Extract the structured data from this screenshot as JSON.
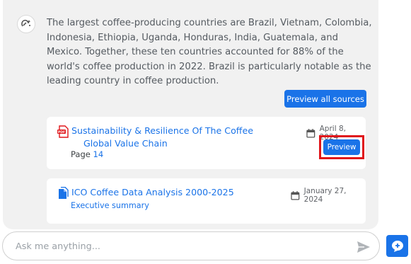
{
  "message": {
    "text": "The largest coffee-producing countries are Brazil, Vietnam, Colombia, Indonesia, Ethiopia, Uganda, Honduras, India, Guatemala, and Mexico. Together, these ten countries accounted for 88% of the world's coffee production in 2022. Brazil is particularly notable as the leading country in coffee production.",
    "preview_all_label": "Preview all sources"
  },
  "sources": [
    {
      "icon": "pdf-icon",
      "title_line1": "Sustainability & Resilience Of The Coffee",
      "title_line2": "Global Value Chain",
      "page_label": "Page",
      "page_number": "14",
      "date": "April 8, 2024",
      "preview_label": "Preview"
    },
    {
      "icon": "document-icon",
      "title": "ICO Coffee Data Analysis 2000-2025",
      "subtitle": "Executive summary",
      "date": "January 27, 2024"
    }
  ],
  "composer": {
    "placeholder": "Ask me anything..."
  },
  "colors": {
    "accent": "#1a73e8",
    "highlight": "#e0161b",
    "panel": "#f1f1f1"
  }
}
